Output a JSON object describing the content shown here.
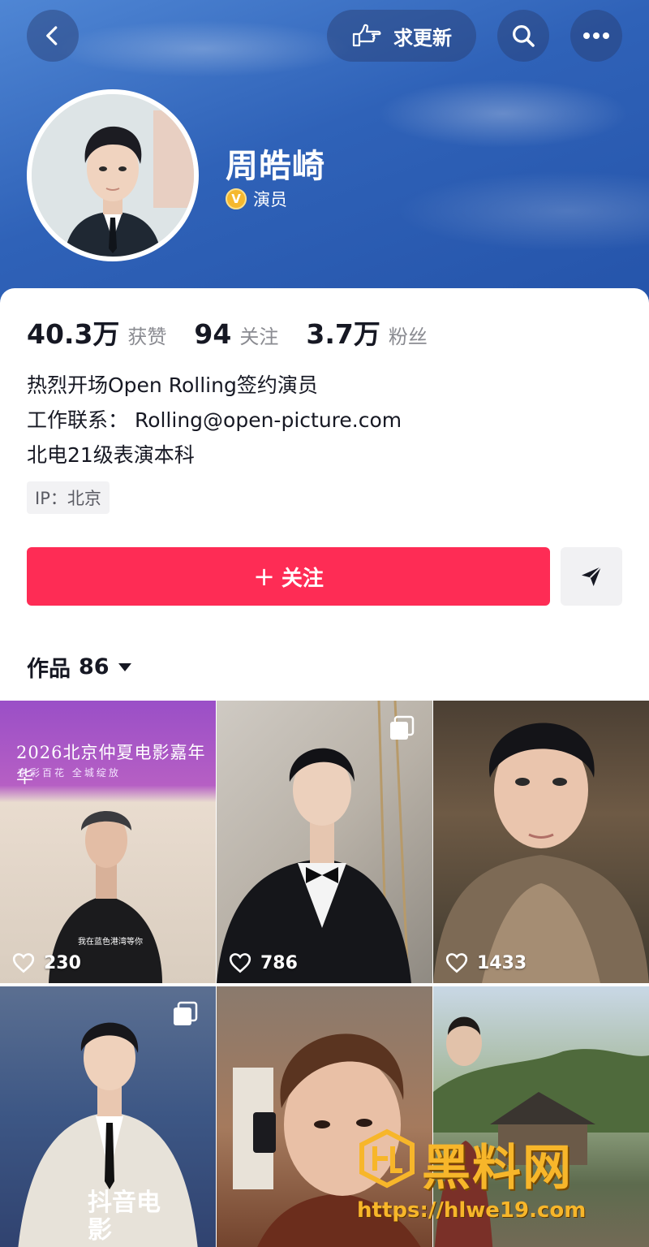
{
  "header": {
    "update_label": "求更新"
  },
  "profile": {
    "name": "周皓崎",
    "verify_badge": "V",
    "verify_label": "演员"
  },
  "stats": [
    {
      "value": "40.3万",
      "label": "获赞"
    },
    {
      "value": "94",
      "label": "关注"
    },
    {
      "value": "3.7万",
      "label": "粉丝"
    }
  ],
  "bio": [
    "热烈开场Open Rolling签约演员",
    "工作联系：  Rolling@open-picture.com",
    "北电21级表演本科"
  ],
  "ip_tag": "IP：北京",
  "actions": {
    "follow_plus": "+",
    "follow_label": "关注"
  },
  "works_tab": {
    "label": "作品",
    "count": "86"
  },
  "videos": [
    {
      "likes": "230",
      "poster_title": "2026北京仲夏电影嘉年华",
      "poster_sub": "京彩百花  全城绽放",
      "caption": "我在蓝色港湾等你"
    },
    {
      "likes": "786"
    },
    {
      "likes": "1433"
    },
    {
      "likes": "",
      "overlay_text": "抖音电影"
    },
    {
      "likes": ""
    },
    {
      "likes": ""
    }
  ],
  "watermark": {
    "title": "黑料网",
    "url": "https://hlwe19.com"
  },
  "colors": {
    "accent": "#fe2c55",
    "header_blue": "#2f62b8",
    "verify_gold": "#f5b82e"
  }
}
